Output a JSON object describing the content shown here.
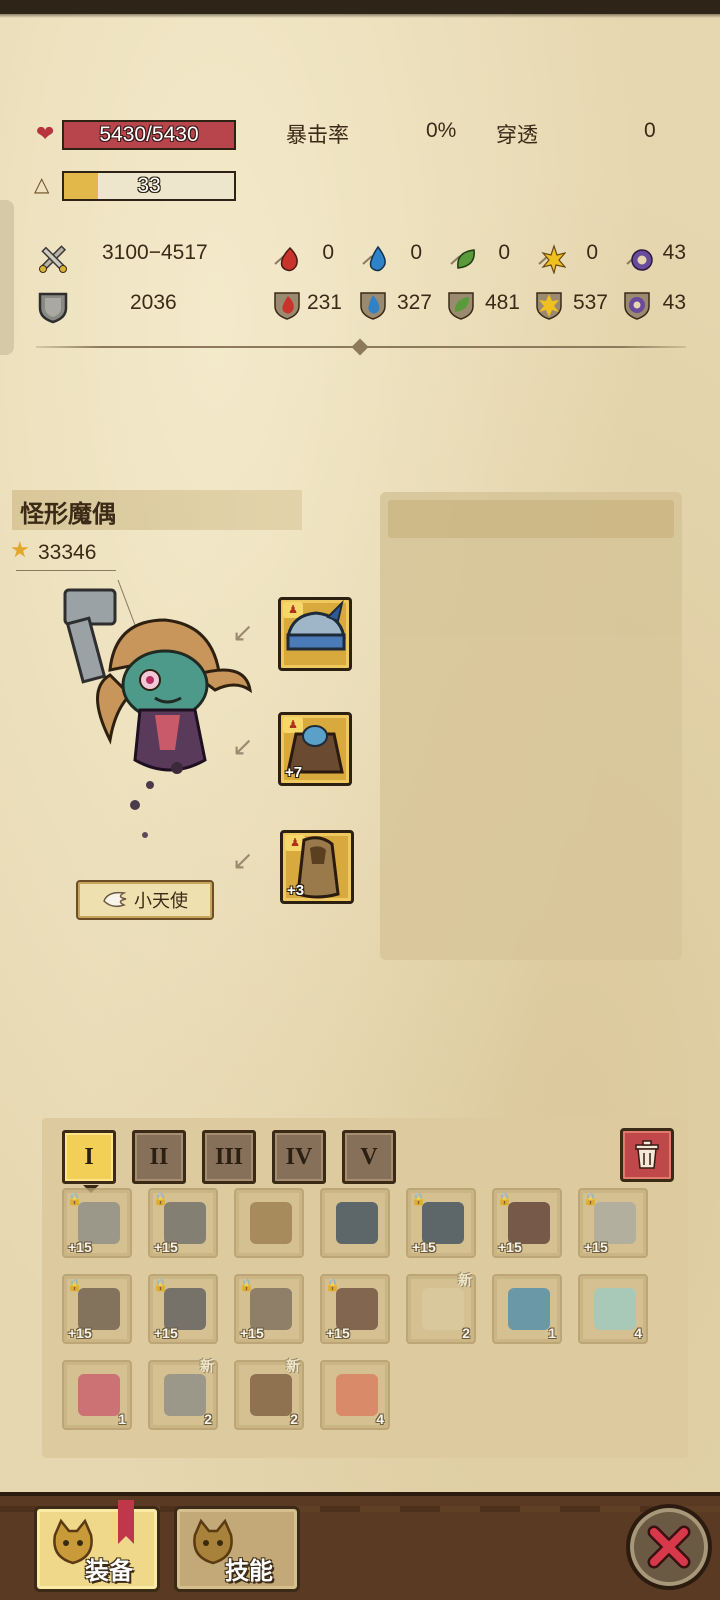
{
  "stats": {
    "hp": "5430/5430",
    "level": "33",
    "level_progress": 0.2,
    "crit_label": "暴击率",
    "crit_value": "0%",
    "pierce_label": "穿透",
    "pierce_value": "0",
    "attack": "3100−4517",
    "defense": "2036",
    "elemental_attack": [
      "0",
      "0",
      "0",
      "0",
      "43"
    ],
    "elemental_resist": [
      "231",
      "327",
      "481",
      "537",
      "43"
    ]
  },
  "character": {
    "name": "怪形魔偶",
    "power": "33346",
    "pet": "小天使"
  },
  "equipment": [
    {
      "slot": "helmet",
      "level": ""
    },
    {
      "slot": "armor",
      "level": "+7"
    },
    {
      "slot": "cloak",
      "level": "+3"
    }
  ],
  "tabs": [
    "I",
    "II",
    "III",
    "IV",
    "V"
  ],
  "inventory": [
    [
      {
        "icon": "sword-icon",
        "plus": "+15",
        "count": "",
        "new": ""
      },
      {
        "icon": "helmet-icon",
        "plus": "+15",
        "count": "",
        "new": ""
      },
      {
        "icon": "bag-icon",
        "plus": "",
        "count": "",
        "new": ""
      },
      {
        "icon": "shoulder-armor-icon",
        "plus": "",
        "count": "",
        "new": ""
      },
      {
        "icon": "shoulder-armor-icon",
        "plus": "+15",
        "count": "",
        "new": ""
      },
      {
        "icon": "chest-armor-icon",
        "plus": "+15",
        "count": "",
        "new": ""
      },
      {
        "icon": "gauntlet-icon",
        "plus": "+15",
        "count": "",
        "new": ""
      }
    ],
    [
      {
        "icon": "mace-icon",
        "plus": "+15",
        "count": "",
        "new": ""
      },
      {
        "icon": "bracer-icon",
        "plus": "+15",
        "count": "",
        "new": ""
      },
      {
        "icon": "whip-icon",
        "plus": "+15",
        "count": "",
        "new": ""
      },
      {
        "icon": "shield-icon",
        "plus": "+15",
        "count": "",
        "new": ""
      },
      {
        "icon": "scroll-icon",
        "plus": "",
        "count": "2",
        "new": "新"
      },
      {
        "icon": "eye-scroll-icon",
        "plus": "",
        "count": "1",
        "new": ""
      },
      {
        "icon": "potion-icon",
        "plus": "",
        "count": "4",
        "new": ""
      }
    ],
    [
      {
        "icon": "star-potion-icon",
        "plus": "",
        "count": "1",
        "new": ""
      },
      {
        "icon": "ore-icon",
        "plus": "",
        "count": "2",
        "new": "新"
      },
      {
        "icon": "chest-icon",
        "plus": "",
        "count": "2",
        "new": "新"
      },
      {
        "icon": "food-bowl-icon",
        "plus": "",
        "count": "4",
        "new": ""
      }
    ]
  ],
  "nav": {
    "equip_label": "装备",
    "skill_label": "技能"
  },
  "colors": {
    "hp_bar": "#b8454c",
    "level_fill": "#e3b84a",
    "active_tab": "#f2cf57",
    "trash": "#c0474a",
    "close_x": "#d8394a"
  }
}
